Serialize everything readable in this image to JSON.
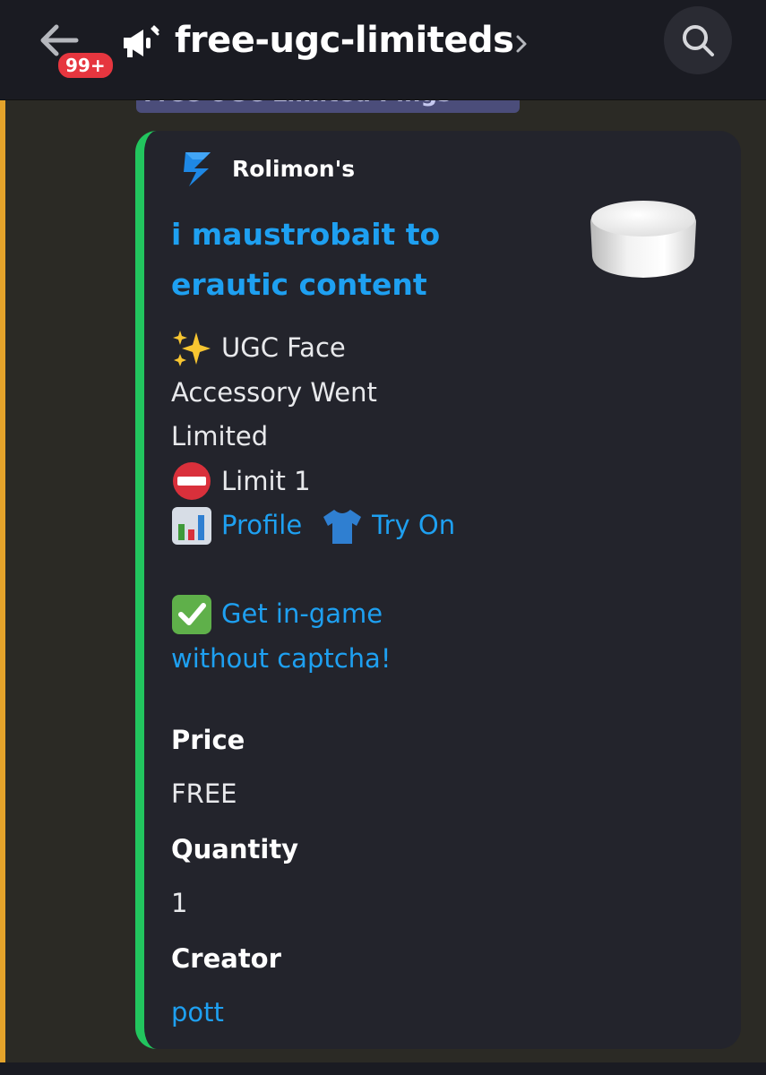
{
  "header": {
    "back_icon": "arrow-left-icon",
    "badge": "99+",
    "channel_icon": "megaphone-icon",
    "channel_name": "free-ugc-limiteds",
    "chevron_icon": "chevron-right-icon",
    "search_icon": "search-icon"
  },
  "reply": {
    "text": "Free UGC Limited Pings"
  },
  "embed": {
    "accent_color": "#22c55e",
    "author": "Rolimon's",
    "title": "i maustrobait to erautic content",
    "thumbnail": "white-cylinder-face-accessory",
    "description": {
      "line1": "UGC Face",
      "line2": "Accessory Went",
      "line3": "Limited",
      "limit": "Limit 1",
      "profile_link": "Profile",
      "tryon_link": "Try On",
      "ingame_line1": "Get in-game",
      "ingame_line2": "without captcha!"
    },
    "fields": [
      {
        "name": "Price",
        "value": "FREE"
      },
      {
        "name": "Quantity",
        "value": "1"
      },
      {
        "name": "Creator",
        "value": "pott"
      }
    ]
  },
  "colors": {
    "link": "#1ea0f1",
    "highlight": "#e4a32b",
    "badge": "#e6363f"
  }
}
